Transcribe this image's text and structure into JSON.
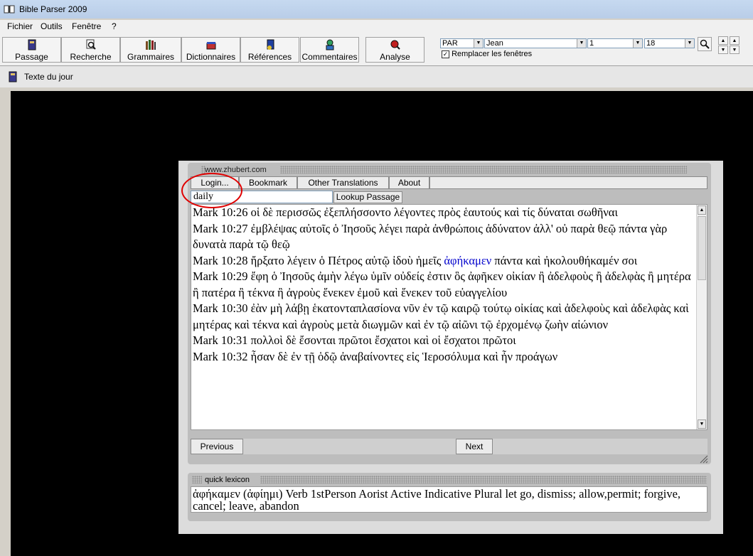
{
  "window": {
    "title": "Bible Parser 2009"
  },
  "menu": {
    "items": [
      "Fichier",
      "Outils",
      "Fenêtre",
      "?"
    ]
  },
  "toolbar": {
    "buttons": [
      {
        "label": "Passage",
        "icon": "book-icon"
      },
      {
        "label": "Recherche",
        "icon": "magnifier-icon"
      },
      {
        "label": "Grammaires",
        "icon": "books-icon"
      },
      {
        "label": "Dictionnaires",
        "icon": "dictionary-icon"
      },
      {
        "label": "Références",
        "icon": "references-icon"
      },
      {
        "label": "Commentaires",
        "icon": "commentary-icon"
      },
      {
        "label": "Analyse",
        "icon": "analysis-icon"
      }
    ],
    "version_select": "PAR",
    "book_select": "Jean",
    "chapter_select": "1",
    "verse_select": "18",
    "replace_windows_label": "Remplacer les fenêtres",
    "replace_windows_checked": true
  },
  "document": {
    "title": "Texte du jour"
  },
  "browser": {
    "url": "www.zhubert.com",
    "nav": [
      "Login...",
      "Bookmark",
      "Other Translations",
      "About"
    ],
    "search_value": "daily",
    "lookup_label": "Lookup Passage",
    "verses": [
      {
        "text": "Mark 10:26 οἱ δὲ περισσῶς ἐξεπλήσσοντο λέγοντες πρὸς ἑαυτούς καὶ τίς δύναται σωθῆναι"
      },
      {
        "text": "Mark 10:27 ἐμβλέψας αὐτοῖς ὁ Ἰησοῦς λέγει παρὰ ἀνθρώποις ἀδύνατον ἀλλ' οὐ παρὰ θεῷ πάντα γὰρ δυνατὰ παρὰ τῷ θεῷ"
      },
      {
        "before": "Mark 10:28 ἤρξατο λέγειν ὁ Πέτρος αὐτῷ ἰδοὺ ἡμεῖς ",
        "highlight": "ἀφήκαμεν",
        "after": " πάντα καὶ ἠκολουθήκαμέν σοι"
      },
      {
        "text": "Mark 10:29 ἔφη ὁ Ἰησοῦς ἀμὴν λέγω ὑμῖν οὐδείς ἐστιν ὃς ἀφῆκεν οἰκίαν ἢ ἀδελφοὺς ἢ ἀδελφὰς ἢ μητέρα ἢ πατέρα ἢ τέκνα ἢ ἀγροὺς ἕνεκεν ἐμοῦ καὶ ἕνεκεν τοῦ εὐαγγελίου"
      },
      {
        "text": "Mark 10:30 ἐὰν μὴ λάβῃ ἑκατονταπλασίονα νῦν ἐν τῷ καιρῷ τούτῳ οἰκίας καὶ ἀδελφοὺς καὶ ἀδελφὰς καὶ μητέρας καὶ τέκνα καὶ ἀγροὺς μετὰ διωγμῶν καὶ ἐν τῷ αἰῶνι τῷ ἐρχομένῳ ζωὴν αἰώνιον"
      },
      {
        "text": "Mark 10:31 πολλοὶ δὲ ἔσονται πρῶτοι ἔσχατοι καὶ οἱ ἔσχατοι πρῶτοι"
      },
      {
        "text": "Mark 10:32 ἦσαν δὲ ἐν τῇ ὁδῷ ἀναβαίνοντες εἰς Ἱεροσόλυμα καὶ ἦν προάγων"
      }
    ],
    "previous_label": "Previous",
    "next_label": "Next"
  },
  "lexicon": {
    "title": "quick lexicon",
    "text": "ἀφήκαμεν (ἀφίημι) Verb 1stPerson Aorist Active Indicative Plural  let go, dismiss; allow,permit; forgive, cancel; leave, abandon"
  },
  "colors": {
    "highlight": "#0000cc",
    "annotation_circle": "#e00000",
    "background": "#000000"
  }
}
